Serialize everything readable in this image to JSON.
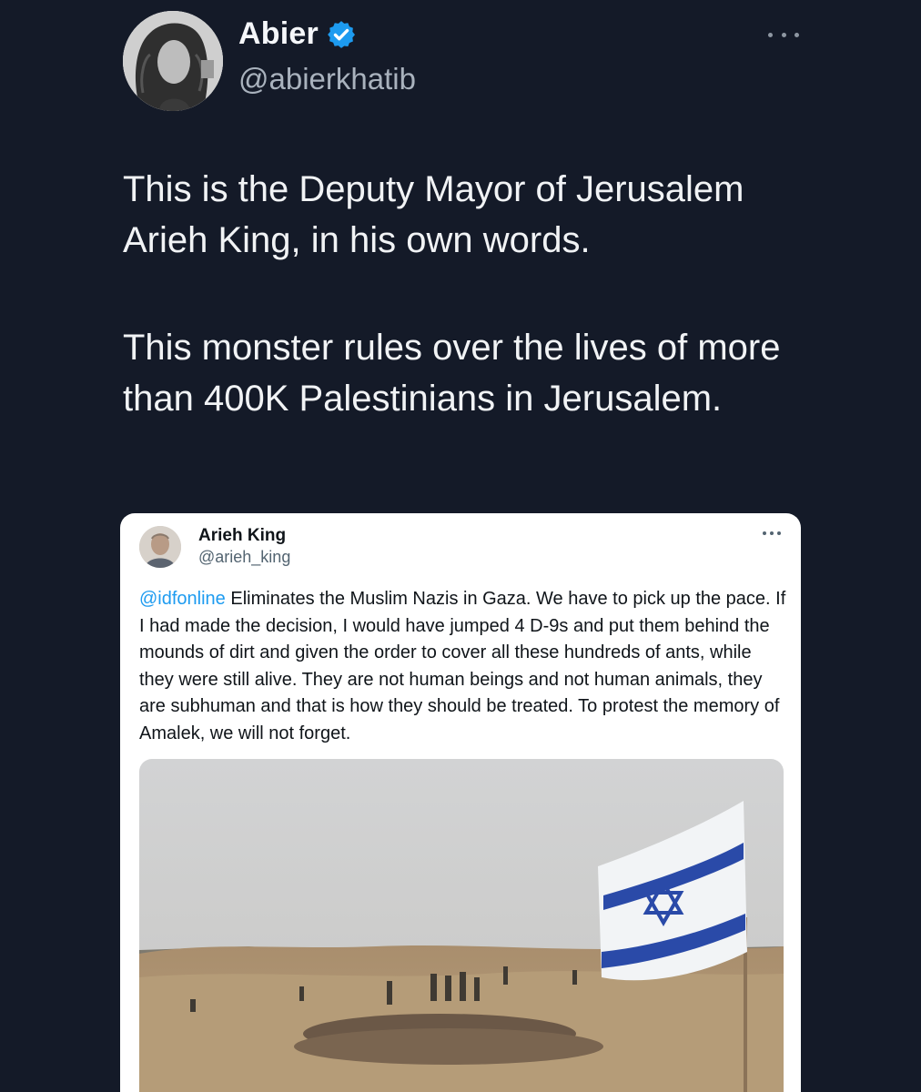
{
  "author": {
    "name": "Abier",
    "handle": "@abierkhatib",
    "verified": true,
    "avatar_icon": "profile-photo"
  },
  "tweet": {
    "paragraphs": [
      "This is the Deputy Mayor of Jerusalem Arieh King, in his own words.",
      "This monster rules over the lives of more than 400K Palestinians in Jerusalem."
    ]
  },
  "quoted": {
    "name": "Arieh King",
    "handle": "@arieh_king",
    "mention": "@idfonline",
    "text": " Eliminates the Muslim Nazis in Gaza. We have to pick up the pace. If I had made the decision, I would have jumped 4 D-9s and put them behind the mounds of dirt and given the order to cover all these hundreds of ants, while they were still alive. They are not human beings and not human animals, they are subhuman and that is how they should be treated. To protest the memory of Amalek, we will not forget.",
    "media_icon": "photo-flag-over-desert"
  },
  "colors": {
    "background": "#141a28",
    "verified_badge": "#1d9bf0",
    "mention": "#1d9bf0",
    "flag_blue": "#2a4aa8"
  }
}
